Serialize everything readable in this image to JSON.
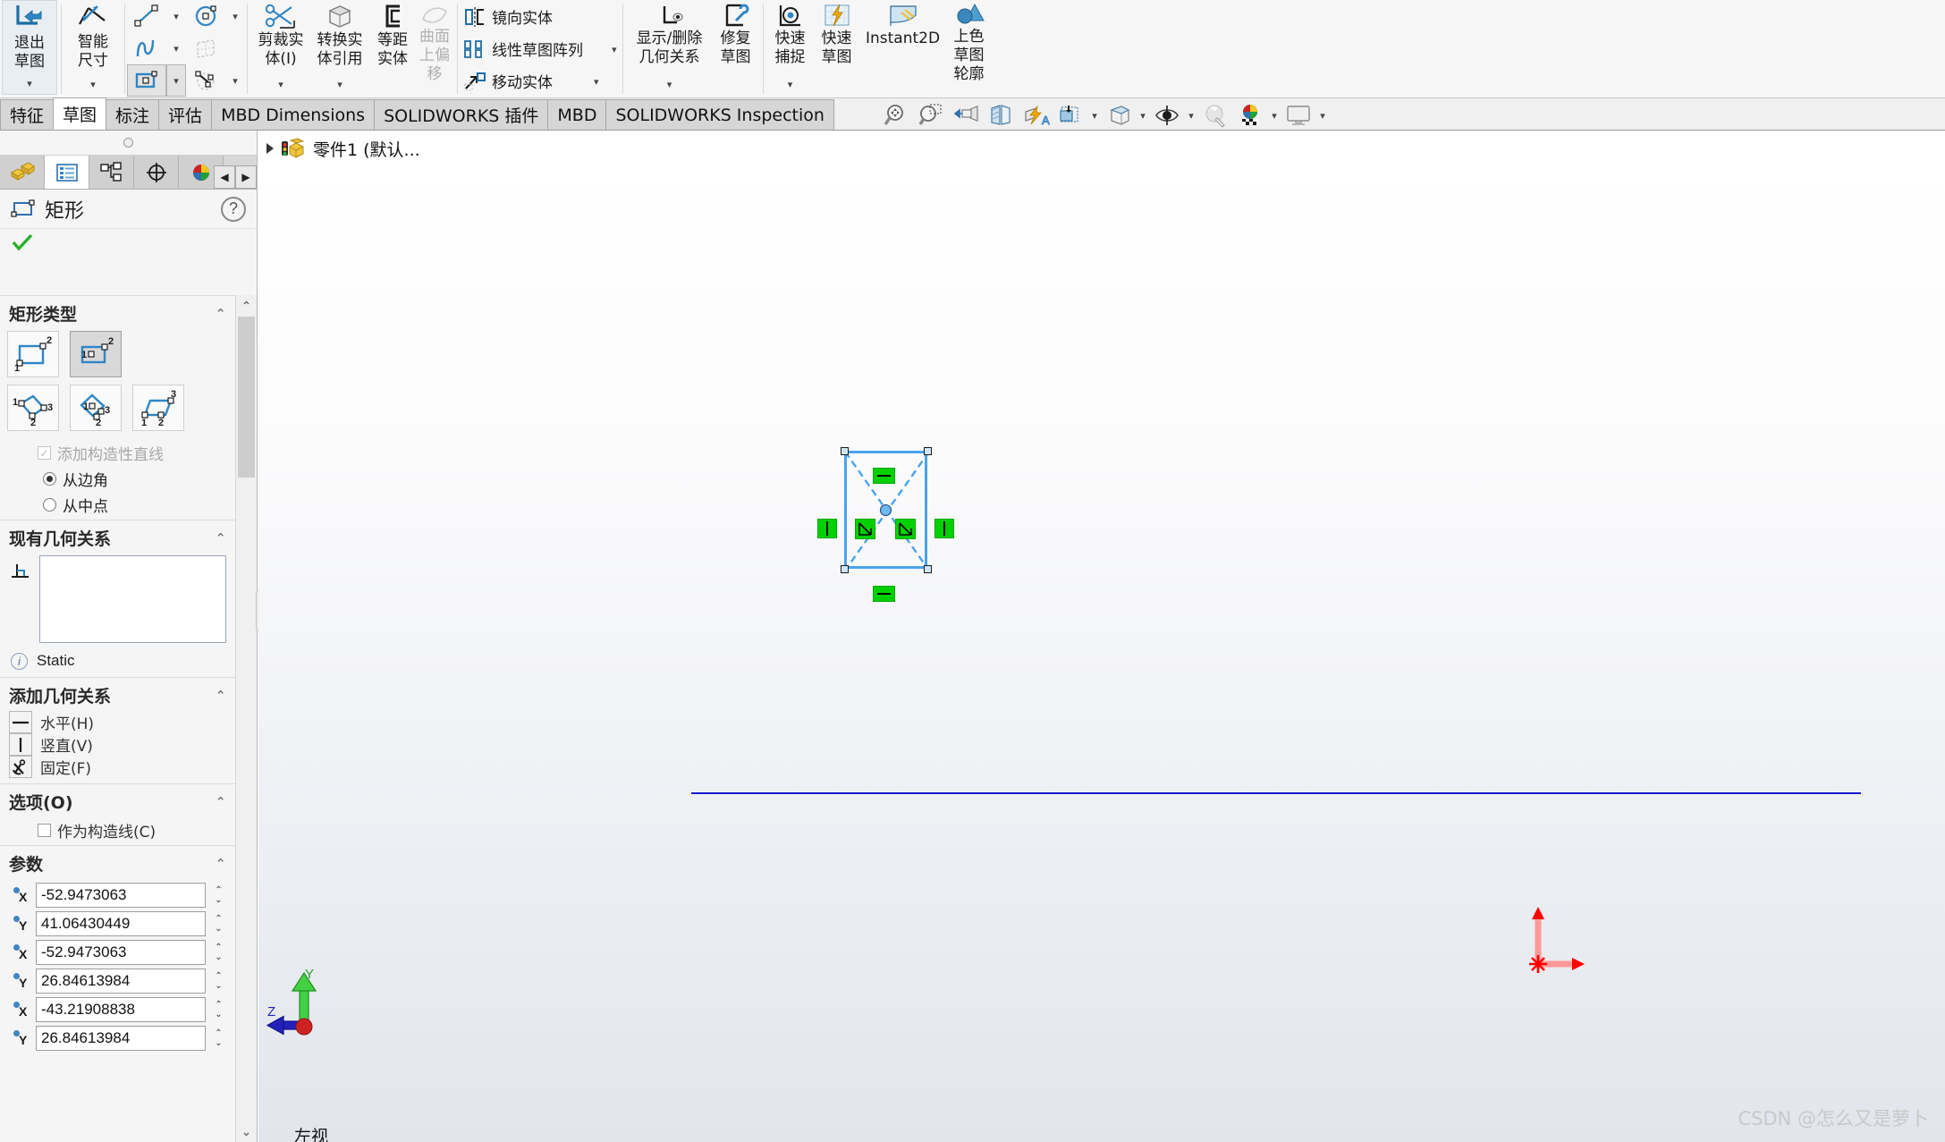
{
  "ribbon": {
    "exit_sketch": {
      "line1": "退出",
      "line2": "草图"
    },
    "smart_dimension": {
      "line1": "智能",
      "line2": "尺寸"
    },
    "sketch_tools": [
      {
        "name": "line-tool",
        "caret": true
      },
      {
        "name": "circle-tool",
        "caret": true
      },
      {
        "name": "spline-tool",
        "caret": true
      },
      {
        "name": "3d-sketch-plane-tool",
        "caret": false
      },
      {
        "name": "rectangle-tool",
        "caret": true,
        "selected": true
      },
      {
        "name": "arc-tool",
        "caret": true
      },
      {
        "name": "ellipse-tool",
        "caret": true
      },
      {
        "name": "text-tool",
        "caret": false
      },
      {
        "name": "slot-tool",
        "caret": true
      },
      {
        "name": "polygon-tool",
        "caret": true
      },
      {
        "name": "fillet-tool",
        "caret": true
      },
      {
        "name": "shaded-area-tool",
        "caret": false
      }
    ],
    "trim_entities": {
      "line1": "剪裁实",
      "line2": "体(I)",
      "caret": true
    },
    "convert_entities": {
      "line1": "转换实",
      "line2": "体引用",
      "caret": true
    },
    "offset_entities": {
      "line1": "等距",
      "line2": "实体"
    },
    "offset_on_surface": {
      "line1": "曲面",
      "line2": "上偏",
      "line3": "移",
      "disabled": true
    },
    "mirror_entities": "镜向实体",
    "linear_sketch_pattern": {
      "label": "线性草图阵列",
      "caret": true
    },
    "move_entities": {
      "label": "移动实体",
      "caret": true
    },
    "display_delete_relations": {
      "line1": "显示/删除",
      "line2": "几何关系",
      "caret": true
    },
    "repair_sketch": {
      "line1": "修复",
      "line2": "草图"
    },
    "quick_snaps": {
      "line1": "快速",
      "line2": "捕捉",
      "caret": true
    },
    "rapid_sketch": {
      "line1": "快速",
      "line2": "草图"
    },
    "instant2d": "Instant2D",
    "shaded_sketch_contours": {
      "line1": "上色",
      "line2": "草图",
      "line3": "轮廓"
    }
  },
  "tabs": [
    {
      "label": "特征",
      "active": false
    },
    {
      "label": "草图",
      "active": true
    },
    {
      "label": "标注",
      "active": false
    },
    {
      "label": "评估",
      "active": false
    },
    {
      "label": "MBD Dimensions",
      "active": false
    },
    {
      "label": "SOLIDWORKS 插件",
      "active": false
    },
    {
      "label": "MBD",
      "active": false
    },
    {
      "label": "SOLIDWORKS Inspection",
      "active": false
    }
  ],
  "view_toolbar": [
    {
      "name": "zoom-to-fit-icon",
      "caret": false
    },
    {
      "name": "zoom-to-area-icon",
      "caret": false
    },
    {
      "name": "previous-view-icon",
      "caret": false
    },
    {
      "name": "section-view-icon",
      "caret": false
    },
    {
      "name": "view-orientation-icon",
      "caret": false
    },
    {
      "name": "display-style-icon",
      "caret": true
    },
    {
      "name": "hide-show-items-icon",
      "caret": true
    },
    {
      "name": "view-settings-icon",
      "caret": true
    },
    {
      "name": "apply-scene-icon",
      "caret": false
    },
    {
      "name": "appearances-icon",
      "caret": true
    },
    {
      "name": "viewport-icon",
      "caret": true
    }
  ],
  "property_manager": {
    "tabs": [
      {
        "name": "feature-manager-tab",
        "active": false
      },
      {
        "name": "property-manager-tab",
        "active": true
      },
      {
        "name": "configuration-manager-tab",
        "active": false
      },
      {
        "name": "dimxpert-manager-tab",
        "active": false
      },
      {
        "name": "display-manager-tab",
        "active": false
      }
    ],
    "nav_prev": "◀",
    "nav_next": "▶",
    "title": "矩形",
    "help": "?",
    "sections": {
      "rect_type": {
        "title": "矩形类型",
        "chevron": "⌃",
        "options": [
          {
            "name": "corner-rectangle",
            "selected": false
          },
          {
            "name": "center-rectangle",
            "selected": true
          },
          {
            "name": "3-point-corner-rectangle",
            "selected": false
          },
          {
            "name": "3-point-center-rectangle",
            "selected": false
          },
          {
            "name": "parallelogram",
            "selected": false
          }
        ],
        "add_construction_lines": {
          "label": "添加构造性直线",
          "checked": true,
          "disabled": true
        },
        "radio_from_corner": {
          "label": "从边角",
          "selected": true
        },
        "radio_from_midpoint": {
          "label": "从中点",
          "selected": false
        }
      },
      "existing_relations": {
        "title": "现有几何关系",
        "chevron": "⌃",
        "list_items": [],
        "status_label": "Static"
      },
      "add_relations": {
        "title": "添加几何关系",
        "chevron": "⌃",
        "items": [
          {
            "label": "水平(H)",
            "name": "horizontal-relation"
          },
          {
            "label": "竖直(V)",
            "name": "vertical-relation"
          },
          {
            "label": "固定(F)",
            "name": "fix-relation"
          }
        ]
      },
      "options": {
        "title": "选项(O)",
        "chevron": "⌃",
        "for_construction": {
          "label": "作为构造线(C)",
          "checked": false
        }
      },
      "parameters": {
        "title": "参数",
        "chevron": "⌃",
        "fields": [
          {
            "axis": "X",
            "value": "-52.9473063"
          },
          {
            "axis": "Y",
            "value": "41.06430449"
          },
          {
            "axis": "X",
            "value": "-52.9473063"
          },
          {
            "axis": "Y",
            "value": "26.84613984"
          },
          {
            "axis": "X",
            "value": "-43.21908838"
          },
          {
            "axis": "Y",
            "value": "26.84613984"
          }
        ]
      }
    }
  },
  "feature_tree": {
    "expander": "▶",
    "root_label": "零件1  (默认..."
  },
  "canvas": {
    "sketch_relations": [
      {
        "name": "horizontal-relation-badge",
        "glyph": "horizontal"
      },
      {
        "name": "horizontal-relation-badge",
        "glyph": "horizontal"
      },
      {
        "name": "vertical-relation-badge",
        "glyph": "vertical"
      },
      {
        "name": "vertical-relation-badge",
        "glyph": "vertical"
      },
      {
        "name": "midpoint-relation-badge",
        "glyph": "midpoint"
      },
      {
        "name": "midpoint-relation-badge",
        "glyph": "midpoint"
      }
    ],
    "triad": {
      "y_label": "Y",
      "z_label": "Z"
    },
    "view_label": "左视",
    "watermark": "CSDN @怎么又是萝卜"
  },
  "colors": {
    "accent_blue": "#4aa3ef",
    "relation_green": "#00d000",
    "origin_red": "#ff0000",
    "axis_blue": "#1515c8",
    "ribbon_bg": "#f6f6f6",
    "panel_bg": "#f5f5f5"
  }
}
